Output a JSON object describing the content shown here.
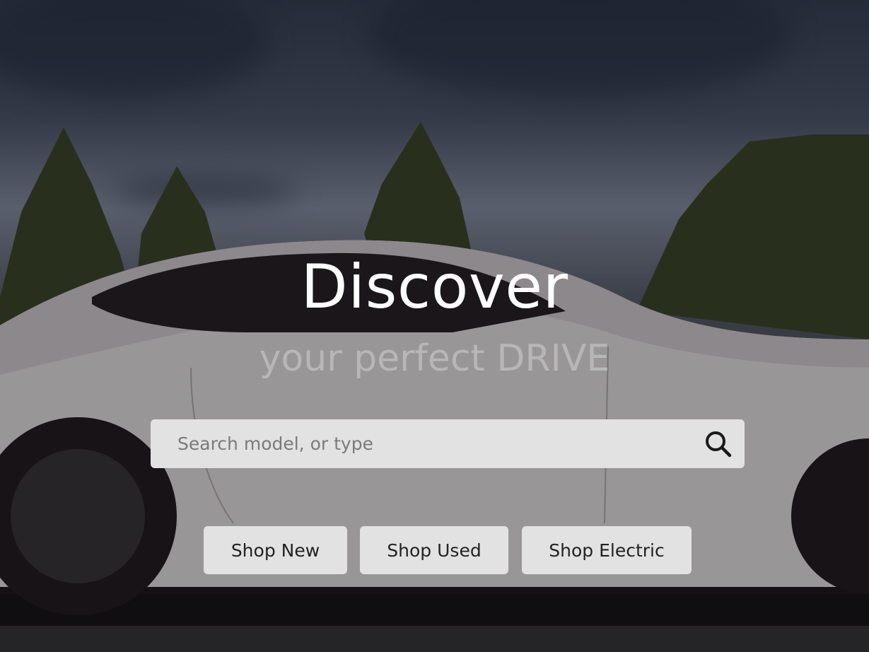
{
  "hero": {
    "headline": "Discover",
    "subheadline": "your perfect DRIVE"
  },
  "search": {
    "placeholder": "Search model, or type",
    "value": "",
    "icon": "search-icon"
  },
  "actions": {
    "shop_new": "Shop New",
    "shop_used": "Shop Used",
    "shop_electric": "Shop Electric"
  },
  "colors": {
    "button_bg": "#e2e2e2",
    "headline": "#ffffff",
    "subheadline": "#b8b6b6"
  }
}
